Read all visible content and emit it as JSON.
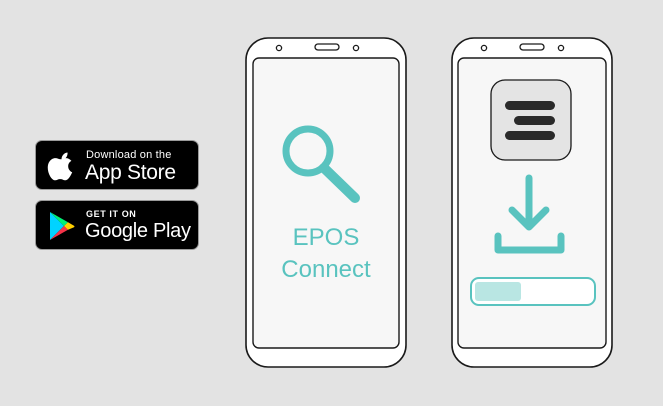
{
  "badges": {
    "app_store": {
      "small": "Download on the",
      "big": "App Store",
      "icon": "apple-icon"
    },
    "google_play": {
      "small": "GET IT ON",
      "big": "Google Play",
      "icon": "google-play-icon"
    }
  },
  "phone_left": {
    "icon": "search-icon",
    "app_name_line1": "EPOS",
    "app_name_line2": "Connect"
  },
  "phone_right": {
    "app_icon": "epos-logo-icon",
    "download_icon": "download-icon",
    "progress": 0.4
  },
  "colors": {
    "accent": "#59c3bf",
    "progress_fill": "#b9e6e3",
    "background": "#e3e3e3"
  }
}
